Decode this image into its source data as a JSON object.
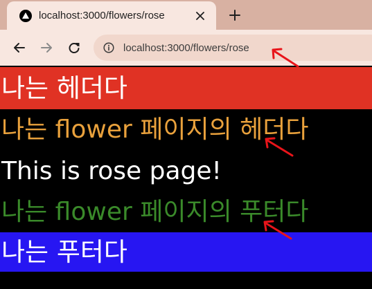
{
  "browser": {
    "tab": {
      "title": "localhost:3000/flowers/rose",
      "favicon": "nextjs-logo-icon",
      "close_icon": "close-icon"
    },
    "new_tab_icon": "plus-icon",
    "toolbar": {
      "back_icon": "arrow-left-icon",
      "forward_icon": "arrow-right-icon",
      "reload_icon": "reload-icon",
      "site_info_icon": "info-icon",
      "url": "localhost:3000/flowers/rose"
    }
  },
  "page": {
    "root_header": "나는 헤더다",
    "flower_header": "나는 flower 페이지의 헤더다",
    "content": "This is rose page!",
    "flower_footer": "나는 flower 페이지의 푸터다",
    "root_footer": "나는 푸터다"
  },
  "colors": {
    "root_header_bg": "#e03224",
    "flower_header_text": "#e9a13c",
    "content_text": "#ffffff",
    "flower_footer_text": "#3a8a2a",
    "root_footer_bg": "#2716f2",
    "page_bg": "#000000",
    "annotation_arrows": "#e8141a"
  }
}
